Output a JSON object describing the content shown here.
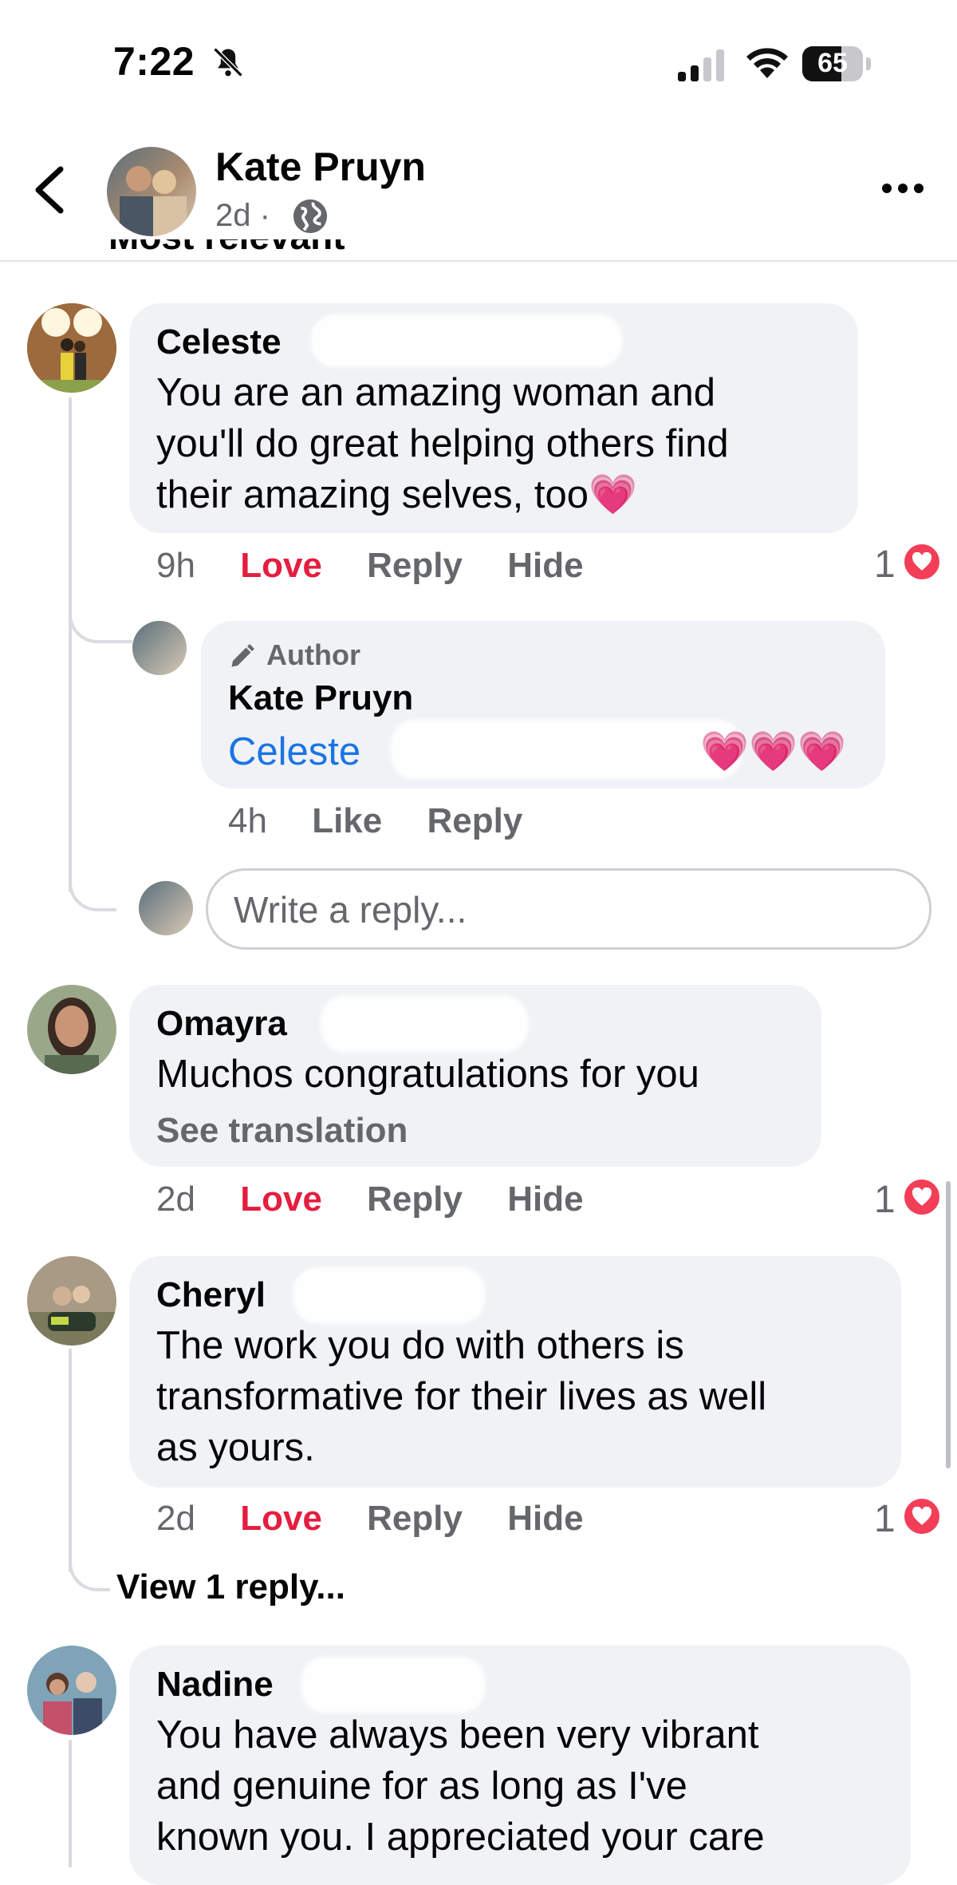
{
  "status_bar": {
    "time": "7:22",
    "battery": "65",
    "battery_level": 0.65
  },
  "header": {
    "author_name": "Kate Pruyn",
    "post_age": "2d",
    "separator": "·",
    "sort_label_cut": "Most relevant"
  },
  "comments": [
    {
      "name": "Celeste",
      "text_lines": [
        "You are an amazing woman and",
        "you'll do great helping others find",
        "their amazing selves, too💗"
      ],
      "time": "9h",
      "love": "Love",
      "reply": "Reply",
      "hide": "Hide",
      "reactions": "1",
      "replies": [
        {
          "badge": "Author",
          "name": "Kate Pruyn",
          "mention": "Celeste",
          "text": "💗💗💗",
          "time": "4h",
          "like": "Like",
          "reply": "Reply"
        }
      ],
      "write_reply_placeholder": "Write a reply..."
    },
    {
      "name": "Omayra",
      "text_lines": [
        "Muchos congratulations for you"
      ],
      "see_translation": "See translation",
      "time": "2d",
      "love": "Love",
      "reply": "Reply",
      "hide": "Hide",
      "reactions": "1"
    },
    {
      "name": "Cheryl",
      "text_lines": [
        "The work you do with others is",
        "transformative for their lives as well",
        "as yours."
      ],
      "time": "2d",
      "love": "Love",
      "reply": "Reply",
      "hide": "Hide",
      "reactions": "1",
      "view_replies": "View 1 reply..."
    },
    {
      "name": "Nadine",
      "text_lines": [
        "You have always been very vibrant",
        "and genuine for as long as I've",
        "known you. I appreciated your care"
      ]
    }
  ],
  "colors": {
    "love": "#e41e3f",
    "link": "#1b74e4",
    "bubble": "#f0f2f5",
    "secondary_text": "#65676b",
    "reaction_heart": "#f33e58"
  },
  "icons": [
    "bell-slash-icon",
    "cellular-signal-icon",
    "wifi-icon",
    "battery-icon",
    "back-chevron-icon",
    "globe-icon",
    "more-icon",
    "pencil-icon",
    "heart-reaction-icon"
  ]
}
